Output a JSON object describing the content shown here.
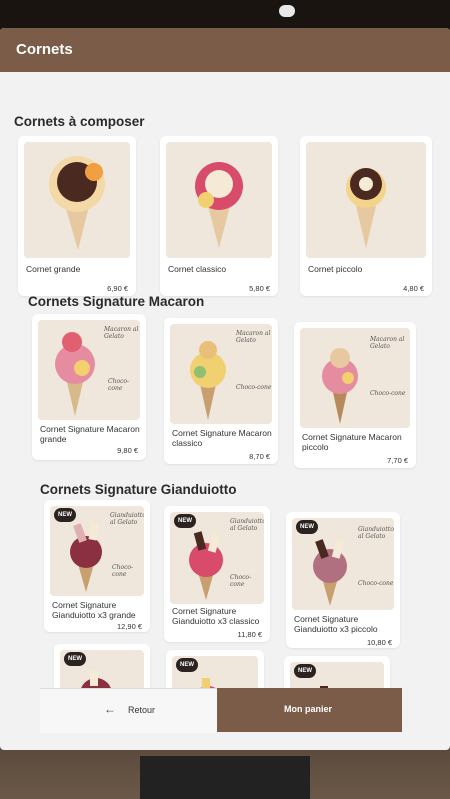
{
  "header": {
    "title": "Cornets"
  },
  "sections": [
    {
      "title": "Cornets à composer",
      "items": [
        {
          "name": "Cornet grande",
          "price": "6,90 €"
        },
        {
          "name": "Cornet classico",
          "price": "5,80 €"
        },
        {
          "name": "Cornet piccolo",
          "price": "4,80 €"
        }
      ]
    },
    {
      "title": "Cornets Signature Macaron",
      "annotations": {
        "top": "Macaron al Gelato",
        "side": "Choco-cone"
      },
      "items": [
        {
          "name": "Cornet Signature Macaron grande",
          "price": "9,80 €"
        },
        {
          "name": "Cornet Signature Macaron classico",
          "price": "8,70 €"
        },
        {
          "name": "Cornet Signature Macaron piccolo",
          "price": "7,70 €"
        }
      ]
    },
    {
      "title": "Cornets Signature Gianduiotto",
      "badge": "NEW",
      "annotations": {
        "top": "Gianduiotto al Gelato",
        "side": "Choco-cone"
      },
      "items": [
        {
          "name": "Cornet Signature Gianduiotto x3 grande",
          "price": "12,90 €"
        },
        {
          "name": "Cornet Signature Gianduiotto x3 classico",
          "price": "11,80 €"
        },
        {
          "name": "Cornet Signature Gianduiotto x3 piccolo",
          "price": "10,80 €"
        }
      ]
    }
  ],
  "footer": {
    "back_label": "Retour",
    "cart_label": "Mon panier"
  },
  "colors": {
    "brand": "#7a5c48",
    "screen_bg": "#f2f2f3",
    "badge": "#2a2320"
  }
}
